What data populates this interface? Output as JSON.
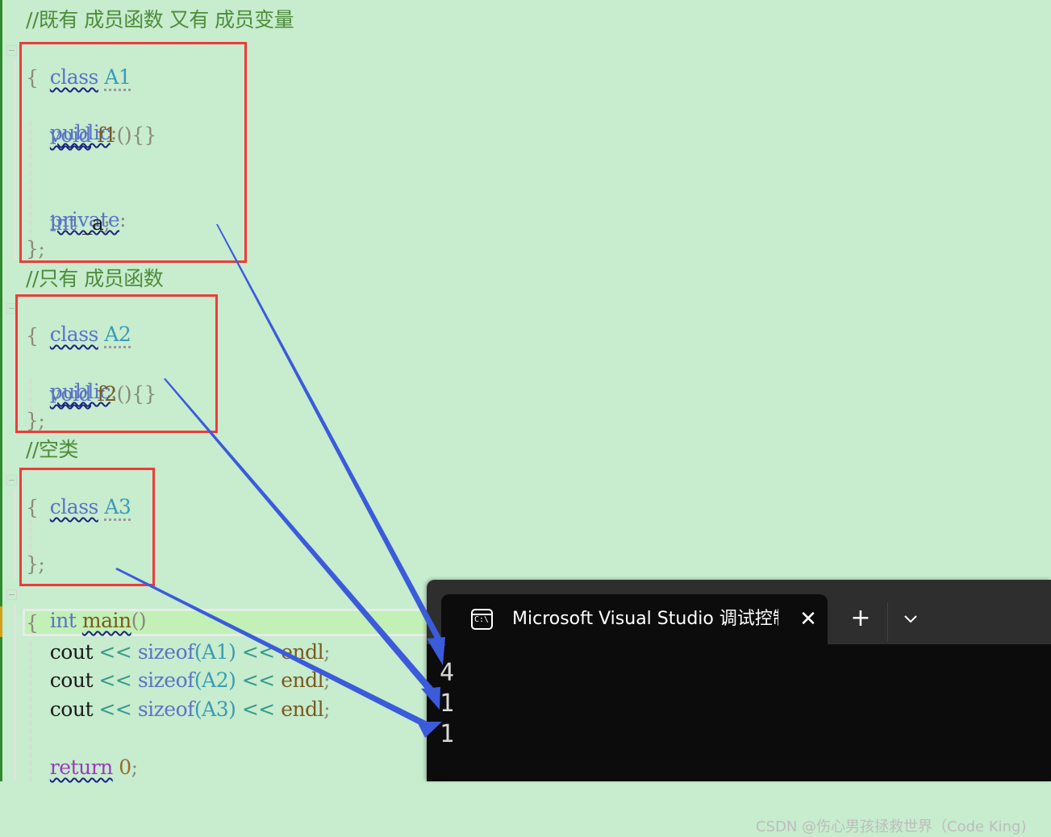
{
  "editor": {
    "comments": {
      "c1": "//既有 成员函数 又有 成员变量",
      "c2": "//只有 成员函数",
      "c3": "//空类"
    },
    "class_a1": {
      "keyword": "class",
      "name": "A1",
      "open_brace": "{",
      "public_kw": "public",
      "colon": ":",
      "void_kw": "void",
      "method": "f1",
      "parens": "()",
      "body": "{}",
      "private_kw": "private",
      "int_kw": "int",
      "member": " _a",
      "semicolon": ";",
      "close": "};"
    },
    "class_a2": {
      "keyword": "class",
      "name": "A2",
      "open_brace": "{",
      "public_kw": "public",
      "colon": ":",
      "void_kw": "void",
      "method": "f2",
      "parens": "()",
      "body": "{}",
      "close": "};"
    },
    "class_a3": {
      "keyword": "class",
      "name": "A3",
      "open_brace": "{",
      "close": "};"
    },
    "main": {
      "int_kw": "int",
      "name": "main",
      "parens": "()",
      "open_brace": "{",
      "lines": [
        {
          "cout": "cout",
          "op1": "<<",
          "sizeof": "sizeof",
          "arg": "(A1)",
          "op2": "<<",
          "endl": "endl",
          "semi": ";"
        },
        {
          "cout": "cout",
          "op1": "<<",
          "sizeof": "sizeof",
          "arg": "(A2)",
          "op2": "<<",
          "endl": "endl",
          "semi": ";"
        },
        {
          "cout": "cout",
          "op1": "<<",
          "sizeof": "sizeof",
          "arg": "(A3)",
          "op2": "<<",
          "endl": "endl",
          "semi": ";"
        }
      ],
      "return_kw": "return",
      "return_val": "0",
      "return_semi": ";"
    }
  },
  "terminal": {
    "tab_title": "Microsoft Visual Studio 调试控制台",
    "icon_text": "C:\\",
    "close_glyph": "✕",
    "new_tab_glyph": "+",
    "output": [
      "4",
      "1",
      "1"
    ]
  },
  "watermark": "CSDN @伤心男孩拯救世界（Code King)",
  "colors": {
    "editor_bg": "#c7ecce",
    "annotation_box": "#ee3b3b",
    "arrow": "#3b5bdb",
    "terminal_bg": "#0c0c0c"
  }
}
